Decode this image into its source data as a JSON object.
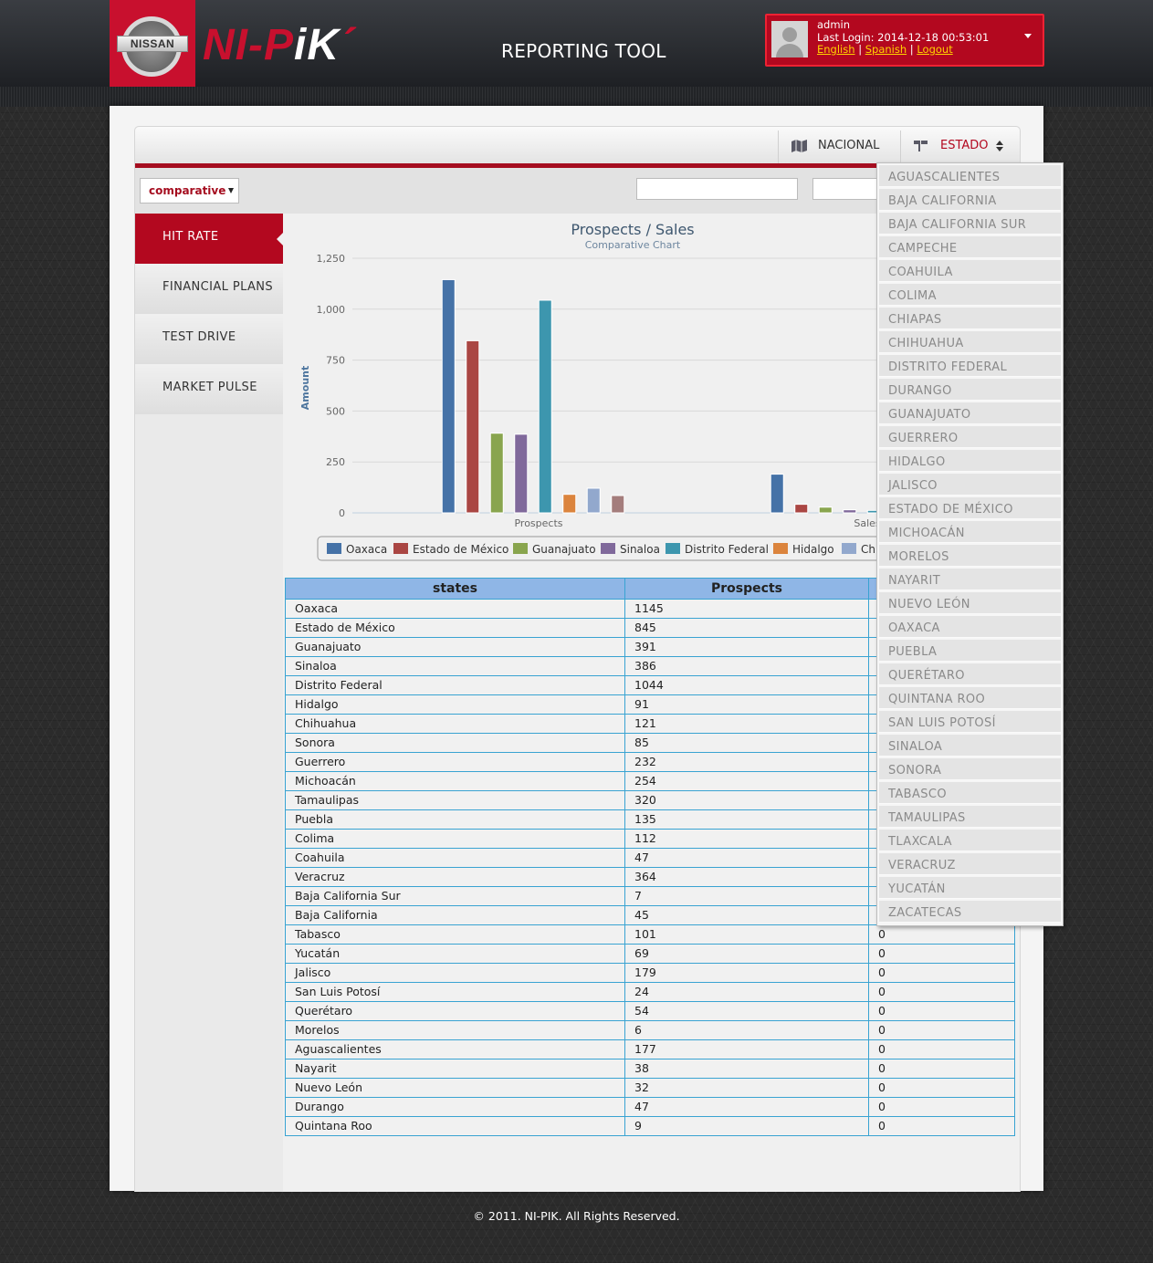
{
  "header": {
    "logo_text": "NISSAN",
    "brand_red": "NI-P",
    "brand_white": "iK",
    "brand_mark": "´",
    "title": "REPORTING TOOL",
    "user": {
      "name": "admin",
      "last_login": "Last Login: 2014-12-18 00:53:01",
      "links": [
        "English",
        "Spanish",
        "Logout"
      ],
      "separator": "|"
    }
  },
  "topnav": {
    "items": [
      {
        "label": "NACIONAL",
        "icon": "map-icon"
      },
      {
        "label": "ESTADO",
        "icon": "flag-icon",
        "active": true
      }
    ]
  },
  "filter": {
    "mode_selected": "comparative",
    "inputs": [
      "",
      ""
    ]
  },
  "sidebar": {
    "items": [
      "HIT RATE",
      "FINANCIAL PLANS",
      "TEST DRIVE",
      "MARKET PULSE"
    ],
    "active_index": 0
  },
  "chart_data": {
    "type": "bar",
    "title": "Prospects / Sales",
    "subtitle": "Comparative Chart",
    "ylabel": "Amount",
    "xlabel": "",
    "ylim": [
      0,
      1250
    ],
    "yticks": [
      "0",
      "250",
      "500",
      "750",
      "1,000",
      "1,250"
    ],
    "categories": [
      "Prospects",
      "Sales"
    ],
    "series": [
      {
        "name": "Oaxaca",
        "color": "#4572a7",
        "values": [
          1145,
          190
        ]
      },
      {
        "name": "Estado de México",
        "color": "#aa4643",
        "values": [
          845,
          42
        ]
      },
      {
        "name": "Guanajuato",
        "color": "#89a54e",
        "values": [
          391,
          28
        ]
      },
      {
        "name": "Sinaloa",
        "color": "#80699b",
        "values": [
          386,
          15
        ]
      },
      {
        "name": "Distrito Federal",
        "color": "#3d96ae",
        "values": [
          1044,
          12
        ]
      },
      {
        "name": "Hidalgo",
        "color": "#db843d",
        "values": [
          91,
          null
        ]
      },
      {
        "name": "Chihuahua",
        "color": "#92a8cd",
        "values": [
          121,
          null
        ]
      },
      {
        "name": "",
        "color": "#a47d7c",
        "values": [
          85,
          null
        ]
      }
    ],
    "legend_visible": [
      "Oaxaca",
      "Estado de México",
      "Guanajuato",
      "Sinaloa",
      "Distrito Federal",
      "Hidalgo",
      "Chi"
    ],
    "legend_position": "bottom",
    "grid": true
  },
  "table": {
    "headers": [
      "states",
      "Prospects",
      ""
    ],
    "rows": [
      [
        "Oaxaca",
        "1145",
        ""
      ],
      [
        "Estado de México",
        "845",
        ""
      ],
      [
        "Guanajuato",
        "391",
        ""
      ],
      [
        "Sinaloa",
        "386",
        ""
      ],
      [
        "Distrito Federal",
        "1044",
        ""
      ],
      [
        "Hidalgo",
        "91",
        ""
      ],
      [
        "Chihuahua",
        "121",
        ""
      ],
      [
        "Sonora",
        "85",
        ""
      ],
      [
        "Guerrero",
        "232",
        ""
      ],
      [
        "Michoacán",
        "254",
        ""
      ],
      [
        "Tamaulipas",
        "320",
        ""
      ],
      [
        "Puebla",
        "135",
        ""
      ],
      [
        "Colima",
        "112",
        ""
      ],
      [
        "Coahuila",
        "47",
        ""
      ],
      [
        "Veracruz",
        "364",
        ""
      ],
      [
        "Baja California Sur",
        "7",
        ""
      ],
      [
        "Baja California",
        "45",
        ""
      ],
      [
        "Tabasco",
        "101",
        "0"
      ],
      [
        "Yucatán",
        "69",
        "0"
      ],
      [
        "Jalisco",
        "179",
        "0"
      ],
      [
        "San Luis Potosí",
        "24",
        "0"
      ],
      [
        "Querétaro",
        "54",
        "0"
      ],
      [
        "Morelos",
        "6",
        "0"
      ],
      [
        "Aguascalientes",
        "177",
        "0"
      ],
      [
        "Nayarit",
        "38",
        "0"
      ],
      [
        "Nuevo León",
        "32",
        "0"
      ],
      [
        "Durango",
        "47",
        "0"
      ],
      [
        "Quintana Roo",
        "9",
        "0"
      ]
    ]
  },
  "dropdown": {
    "items": [
      "AGUASCALIENTES",
      "BAJA CALIFORNIA",
      "BAJA CALIFORNIA SUR",
      "CAMPECHE",
      "COAHUILA",
      "COLIMA",
      "CHIAPAS",
      "CHIHUAHUA",
      "DISTRITO FEDERAL",
      "DURANGO",
      "GUANAJUATO",
      "GUERRERO",
      "HIDALGO",
      "JALISCO",
      "ESTADO DE MÉXICO",
      "MICHOACÁN",
      "MORELOS",
      "NAYARIT",
      "NUEVO LEÓN",
      "OAXACA",
      "PUEBLA",
      "QUERÉTARO",
      "QUINTANA ROO",
      "SAN LUIS POTOSÍ",
      "SINALOA",
      "SONORA",
      "TABASCO",
      "TAMAULIPAS",
      "TLAXCALA",
      "VERACRUZ",
      "YUCATÁN",
      "ZACATECAS"
    ]
  },
  "footer": {
    "text": "© 2011. NI-PIK. All Rights Reserved."
  }
}
